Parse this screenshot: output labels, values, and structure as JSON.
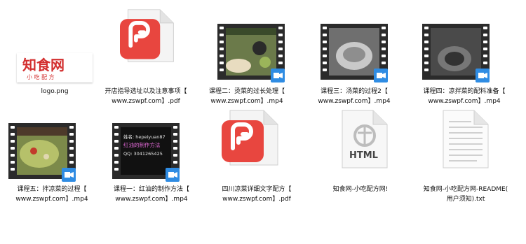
{
  "colors": {
    "pdf_red": "#e8463f",
    "video_badge_blue": "#2f8ce3",
    "html_gray": "#444444",
    "logo_red": "#d32f2f"
  },
  "logo": {
    "title": "知食网",
    "subtitle": "小 吃 配 方"
  },
  "html_icon": {
    "label": "HTML"
  },
  "video_overlay": {
    "line1": "姓名: hepeiyuan87",
    "line2": "红油的制作方法",
    "line3": "QQ: 3041265425"
  },
  "files": [
    {
      "name": "logo.png",
      "lines": [
        "logo.png"
      ],
      "icon": "image-icon"
    },
    {
      "name": "开店指导选址以及注意事项【www.zswpf.com】.pdf",
      "lines": [
        "开店指导选址以及注意事项【",
        "www.zswpf.com】.pdf"
      ],
      "icon": "pdf-icon"
    },
    {
      "name": "课程二：烫菜的过长处理【www.zswpf.com】.mp4",
      "lines": [
        "课程二：烫菜的过长处理【",
        "www.zswpf.com】.mp4"
      ],
      "icon": "video-icon"
    },
    {
      "name": "课程三：汤菜的过程2【www.zswpf.com】.mp4",
      "lines": [
        "课程三：汤菜的过程2【",
        "www.zswpf.com】.mp4"
      ],
      "icon": "video-icon"
    },
    {
      "name": "课程四：凉拌菜的配料准备【www.zswpf.com】.mp4",
      "lines": [
        "课程四：凉拌菜的配料准备【",
        "www.zswpf.com】.mp4"
      ],
      "icon": "video-icon"
    },
    {
      "name": "课程五：拌凉菜的过程【www.zswpf.com】.mp4",
      "lines": [
        "课程五：拌凉菜的过程【",
        "www.zswpf.com】.mp4"
      ],
      "icon": "video-icon"
    },
    {
      "name": "课程一：红油的制作方法【www.zswpf.com】.mp4",
      "lines": [
        "课程一：红油的制作方法【",
        "www.zswpf.com】.mp4"
      ],
      "icon": "video-icon"
    },
    {
      "name": "四川凉菜详细文字配方【www.zswpf.com】.pdf",
      "lines": [
        "四川凉菜详细文字配方【",
        "www.zswpf.com】.pdf"
      ],
      "icon": "pdf-icon"
    },
    {
      "name": "知食网-小吃配方网!",
      "lines": [
        "知食网-小吃配方网!"
      ],
      "icon": "html-file-icon"
    },
    {
      "name": "知食网-小吃配方网-README(用户须知).txt",
      "lines": [
        "知食网-小吃配方网-README(",
        "用户须知).txt"
      ],
      "icon": "text-file-icon"
    }
  ]
}
